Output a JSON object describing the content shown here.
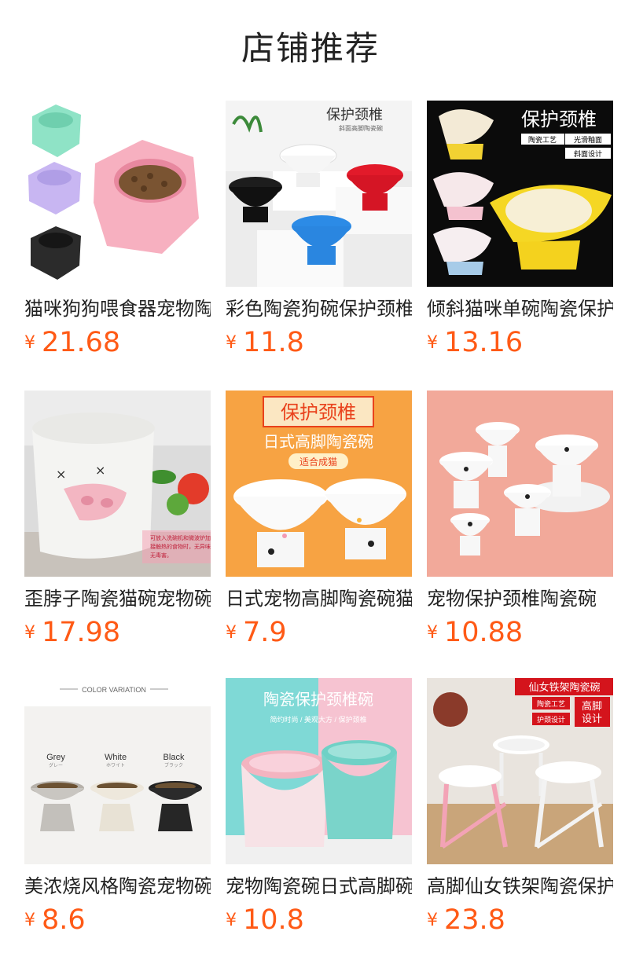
{
  "section_title": "店铺推荐",
  "currency_symbol": "¥",
  "accent_color": "#ff5a16",
  "products": [
    {
      "name": "猫咪狗狗喂食器宠物陶瓷碗",
      "price": "21.68",
      "image": {
        "overlay_text": []
      }
    },
    {
      "name": "彩色陶瓷狗碗保护颈椎",
      "price": "11.8",
      "image": {
        "overlay_text": [
          "保护颈椎",
          "斜面高脚陶瓷碗"
        ]
      }
    },
    {
      "name": "倾斜猫咪单碗陶瓷保护颈椎",
      "price": "13.16",
      "image": {
        "overlay_text": [
          "保护颈椎",
          "陶瓷工艺",
          "光滑釉面",
          "斜面设计"
        ]
      }
    },
    {
      "name": "歪脖子陶瓷猫碗宠物碗",
      "price": "17.98",
      "image": {
        "overlay_text": [
          "可放入洗碗机和微波炉加热，",
          "接触热的食物时，无异味，",
          "无毒害。"
        ]
      }
    },
    {
      "name": "日式宠物高脚陶瓷碗猫碗",
      "price": "7.9",
      "image": {
        "overlay_text": [
          "保护颈椎",
          "日式高脚陶瓷碗",
          "适合成猫"
        ]
      }
    },
    {
      "name": "宠物保护颈椎陶瓷碗",
      "price": "10.88",
      "image": {
        "overlay_text": []
      }
    },
    {
      "name": "美浓烧风格陶瓷宠物碗",
      "price": "8.6",
      "image": {
        "overlay_text": [
          "COLOR VARIATION",
          "Grey",
          "グレー",
          "White",
          "ホワイト",
          "Black",
          "ブラック"
        ]
      }
    },
    {
      "name": "宠物陶瓷碗日式高脚碗",
      "price": "10.8",
      "image": {
        "overlay_text": [
          "陶瓷保护颈椎碗",
          "简约时尚 / 美观大方 / 保护颈椎"
        ]
      }
    },
    {
      "name": "高脚仙女铁架陶瓷保护颈椎",
      "price": "23.8",
      "image": {
        "overlay_text": [
          "仙女铁架陶瓷碗",
          "陶瓷工艺",
          "护颈设计",
          "高脚",
          "设计"
        ]
      }
    }
  ]
}
